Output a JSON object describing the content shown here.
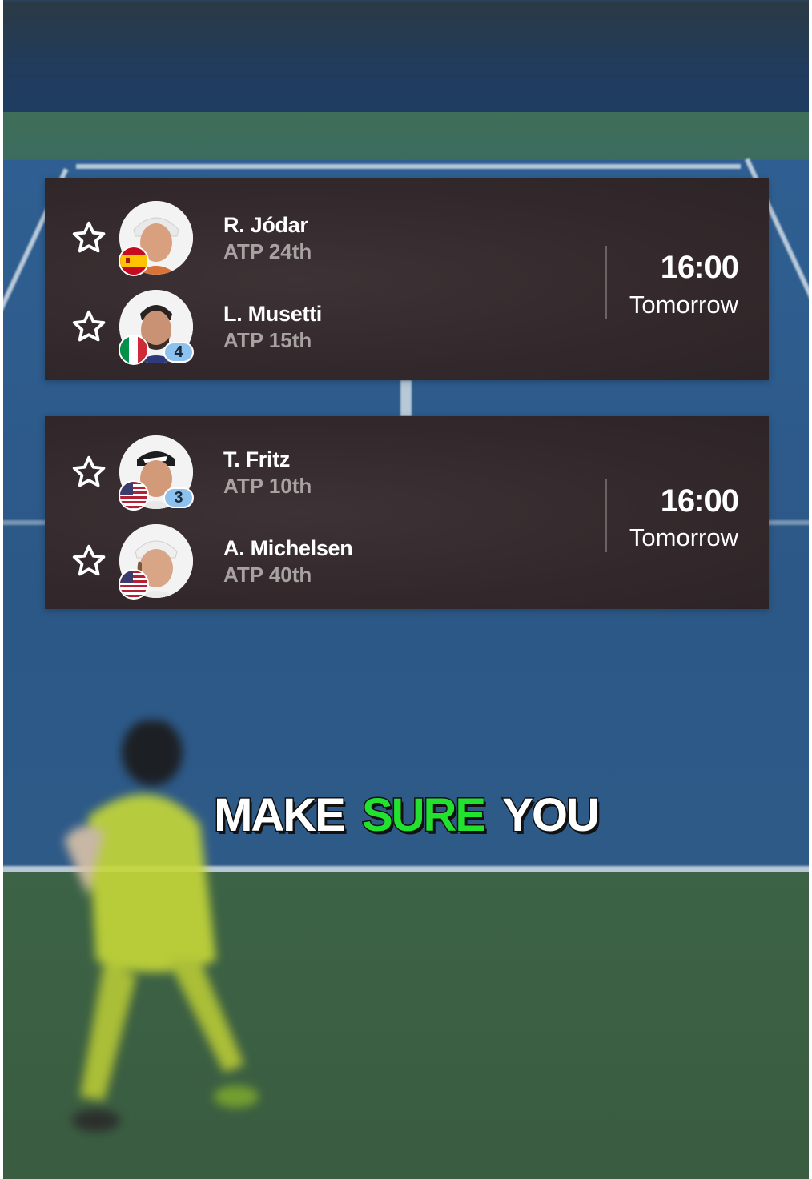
{
  "matches": [
    {
      "time": "16:00",
      "day": "Tomorrow",
      "players": [
        {
          "name": "R. Jódar",
          "rank": "ATP 24th",
          "country": "Spain",
          "seed": ""
        },
        {
          "name": "L. Musetti",
          "rank": "ATP 15th",
          "country": "Italy",
          "seed": "4"
        }
      ]
    },
    {
      "time": "16:00",
      "day": "Tomorrow",
      "players": [
        {
          "name": "T. Fritz",
          "rank": "ATP 10th",
          "country": "USA",
          "seed": "3"
        },
        {
          "name": "A. Michelsen",
          "rank": "ATP 40th",
          "country": "USA",
          "seed": ""
        }
      ]
    }
  ],
  "caption": {
    "words": [
      "MAKE",
      "SURE",
      "YOU"
    ],
    "highlight_color": "#22e12f"
  },
  "icons": {
    "favorite": "star-outline-icon"
  },
  "colors": {
    "card_bg": "#33292c",
    "rank_text": "#a8a2a3",
    "seed_badge": "#8ec2ee"
  }
}
